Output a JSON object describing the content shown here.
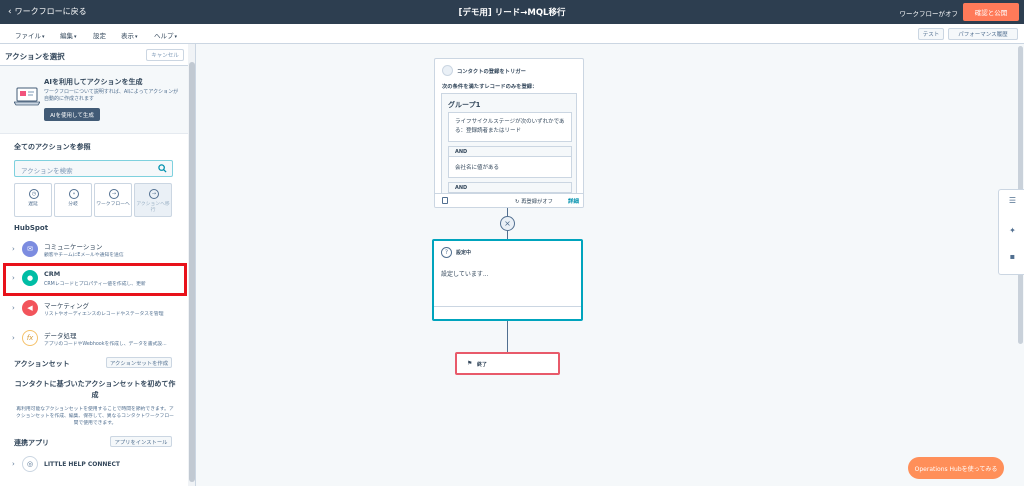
{
  "topbar": {
    "back_label": "ワークフローに戻る",
    "title": "[デモ用] リード→MQL移行",
    "status": "ワークフローがオフ",
    "publish_label": "確認と公開"
  },
  "menubar": {
    "items": [
      {
        "label": "ファイル",
        "has_chevron": true
      },
      {
        "label": "編集",
        "has_chevron": true
      },
      {
        "label": "設定",
        "has_chevron": false
      },
      {
        "label": "表示",
        "has_chevron": true
      },
      {
        "label": "ヘルプ",
        "has_chevron": true
      }
    ],
    "test_label": "テスト",
    "perf_label": "パフォーマンス履歴"
  },
  "panel": {
    "title": "アクションを選択",
    "cancel_label": "キャンセル",
    "ai": {
      "title": "AIを利用してアクションを生成",
      "desc": "ワークフローについて説明すれば、AIによってアクションが自動的に作成されます",
      "button": "AIを使用して生成"
    },
    "browse_heading": "全てのアクションを参照",
    "search_placeholder": "アクションを検索",
    "tiles": [
      {
        "label": "遅延",
        "icon": "delay-icon"
      },
      {
        "label": "分岐",
        "icon": "branch-icon"
      },
      {
        "label": "ワークフローへ",
        "icon": "arrow-right-icon"
      },
      {
        "label": "アクションへ移行",
        "icon": "arrow-right-icon"
      }
    ],
    "hubspot_heading": "HubSpot",
    "categories": [
      {
        "title": "コミュニケーション",
        "desc": "顧客やチームにEメールや通知を送信",
        "color": "#7c8ce0"
      },
      {
        "title": "CRM",
        "desc": "CRMレコードとプロパティー値を作成し、更新",
        "color": "#00bda5"
      },
      {
        "title": "マーケティング",
        "desc": "リストやオーディエンスのレコードやステータスを管理",
        "color": "#f2545b"
      },
      {
        "title": "データ処理",
        "desc": "アプリのコードやWebhookを作成し、データを書式設...",
        "color": "#f5c26b"
      }
    ],
    "action_sets_heading": "アクションセット",
    "action_sets_button": "アクションセットを作成",
    "action_sets_title": "コンタクトに基づいたアクションセットを初めて作成",
    "action_sets_desc": "再利用可能なアクションセットを使用することで時間を節約できます。アクションセットを作成、編集、保存して、異なるコンタクトワークフロー間で使用できます。",
    "apps_heading": "連携アプリ",
    "apps_button": "アプリをインストール",
    "app_item": "LITTLE HELP CONNECT"
  },
  "trigger": {
    "title": "コンタクトの登録をトリガー",
    "subtitle": "次の条件を満たすレコードのみを登録：",
    "group_title": "グループ1",
    "cond1": "ライフサイクルステージが次のいずれかである：登録読者またはリード",
    "and1": "AND",
    "cond2": "会社名に値がある",
    "and2": "AND",
    "reenroll": "再登録がオフ",
    "detail": "詳細"
  },
  "setting": {
    "title": "設定中",
    "text": "設定しています..."
  },
  "end": {
    "label": "終了"
  },
  "ops": {
    "label": "Operations Hubを使ってみる"
  }
}
